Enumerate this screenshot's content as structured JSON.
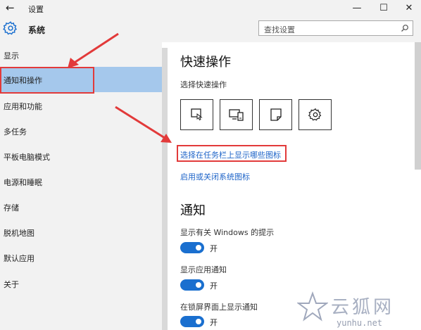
{
  "window": {
    "back_glyph": "←",
    "title": "设置",
    "controls": {
      "minimize": "—",
      "maximize": "☐",
      "close": "✕"
    }
  },
  "header": {
    "icon": "gear-icon",
    "title": "系统",
    "search_placeholder": "查找设置",
    "search_icon": "search-icon"
  },
  "sidebar": {
    "items": [
      {
        "label": "显示"
      },
      {
        "label": "通知和操作",
        "active": true
      },
      {
        "label": "应用和功能"
      },
      {
        "label": "多任务"
      },
      {
        "label": "平板电脑模式"
      },
      {
        "label": "电源和睡眠"
      },
      {
        "label": "存储"
      },
      {
        "label": "脱机地图"
      },
      {
        "label": "默认应用"
      },
      {
        "label": "关于"
      }
    ]
  },
  "main": {
    "quick_actions": {
      "title": "快速操作",
      "subtitle": "选择快速操作",
      "buttons": [
        {
          "icon": "tablet-mode-icon"
        },
        {
          "icon": "connect-display-icon"
        },
        {
          "icon": "note-icon"
        },
        {
          "icon": "settings-gear-icon"
        }
      ]
    },
    "links": {
      "taskbar_icons": "选择在任务栏上显示哪些图标",
      "system_icons": "启用或关闭系统图标"
    },
    "notifications": {
      "title": "通知",
      "options": [
        {
          "label": "显示有关 Windows 的提示",
          "state": "开",
          "on": true
        },
        {
          "label": "显示应用通知",
          "state": "开",
          "on": true
        },
        {
          "label": "在锁屏界面上显示通知",
          "state": "开",
          "on": true
        }
      ]
    }
  },
  "watermark": {
    "text_cn": "云狐网",
    "url": "yunhu.net"
  },
  "colors": {
    "accent": "#1a6fcf",
    "link": "#1e64c8",
    "sidebar_bg": "#f2f2f2",
    "active_item": "#a5c8ec",
    "annotation_red": "#e23a3a"
  }
}
